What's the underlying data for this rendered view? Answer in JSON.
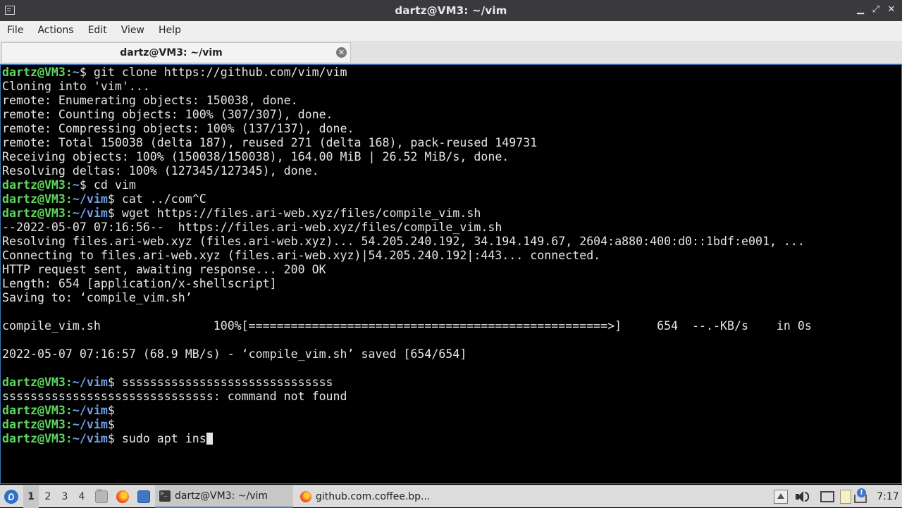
{
  "window": {
    "title": "dartz@VM3: ~/vim"
  },
  "menubar": {
    "items": [
      "File",
      "Actions",
      "Edit",
      "View",
      "Help"
    ]
  },
  "tab": {
    "label": "dartz@VM3: ~/vim"
  },
  "terminal": {
    "lines": [
      {
        "user": "dartz@VM3:",
        "path": "~",
        "cmd": "$ git clone https://github.com/vim/vim"
      },
      {
        "text": "Cloning into 'vim'..."
      },
      {
        "text": "remote: Enumerating objects: 150038, done."
      },
      {
        "text": "remote: Counting objects: 100% (307/307), done."
      },
      {
        "text": "remote: Compressing objects: 100% (137/137), done."
      },
      {
        "text": "remote: Total 150038 (delta 187), reused 271 (delta 168), pack-reused 149731"
      },
      {
        "text": "Receiving objects: 100% (150038/150038), 164.00 MiB | 26.52 MiB/s, done."
      },
      {
        "text": "Resolving deltas: 100% (127345/127345), done."
      },
      {
        "user": "dartz@VM3:",
        "path": "~",
        "cmd": "$ cd vim"
      },
      {
        "user": "dartz@VM3:",
        "path": "~/vim",
        "cmd": "$ cat ../com^C"
      },
      {
        "user": "dartz@VM3:",
        "path": "~/vim",
        "cmd": "$ wget https://files.ari-web.xyz/files/compile_vim.sh"
      },
      {
        "text": "--2022-05-07 07:16:56--  https://files.ari-web.xyz/files/compile_vim.sh"
      },
      {
        "text": "Resolving files.ari-web.xyz (files.ari-web.xyz)... 54.205.240.192, 34.194.149.67, 2604:a880:400:d0::1bdf:e001, ..."
      },
      {
        "text": "Connecting to files.ari-web.xyz (files.ari-web.xyz)|54.205.240.192|:443... connected."
      },
      {
        "text": "HTTP request sent, awaiting response... 200 OK"
      },
      {
        "text": "Length: 654 [application/x-shellscript]"
      },
      {
        "text": "Saving to: ‘compile_vim.sh’"
      },
      {
        "text": ""
      },
      {
        "text": "compile_vim.sh                100%[===================================================>]     654  --.-KB/s    in 0s"
      },
      {
        "text": ""
      },
      {
        "text": "2022-05-07 07:16:57 (68.9 MB/s) - ‘compile_vim.sh’ saved [654/654]"
      },
      {
        "text": ""
      },
      {
        "user": "dartz@VM3:",
        "path": "~/vim",
        "cmd": "$ ssssssssssssssssssssssssssssss"
      },
      {
        "text": "ssssssssssssssssssssssssssssss: command not found"
      },
      {
        "user": "dartz@VM3:",
        "path": "~/vim",
        "cmd": "$"
      },
      {
        "user": "dartz@VM3:",
        "path": "~/vim",
        "cmd": "$"
      },
      {
        "user": "dartz@VM3:",
        "path": "~/vim",
        "cmd": "$ sudo apt ins",
        "cursor": true
      }
    ]
  },
  "taskbar": {
    "workspaces": [
      "1",
      "2",
      "3",
      "4"
    ],
    "active_workspace": "1",
    "tasks": [
      {
        "label": "dartz@VM3: ~/vim",
        "icon": "terminal-icon",
        "active": true
      },
      {
        "label": "github.com.coffee.bp...",
        "icon": "firefox-icon",
        "active": false
      }
    ],
    "clock": "7:17"
  },
  "colors": {
    "prompt_user": "#5fd75f",
    "prompt_path": "#6f9fe6",
    "terminal_bg": "#000000",
    "terminal_fg": "#e5e5e5",
    "titlebar_bg": "#3a3a3e"
  }
}
